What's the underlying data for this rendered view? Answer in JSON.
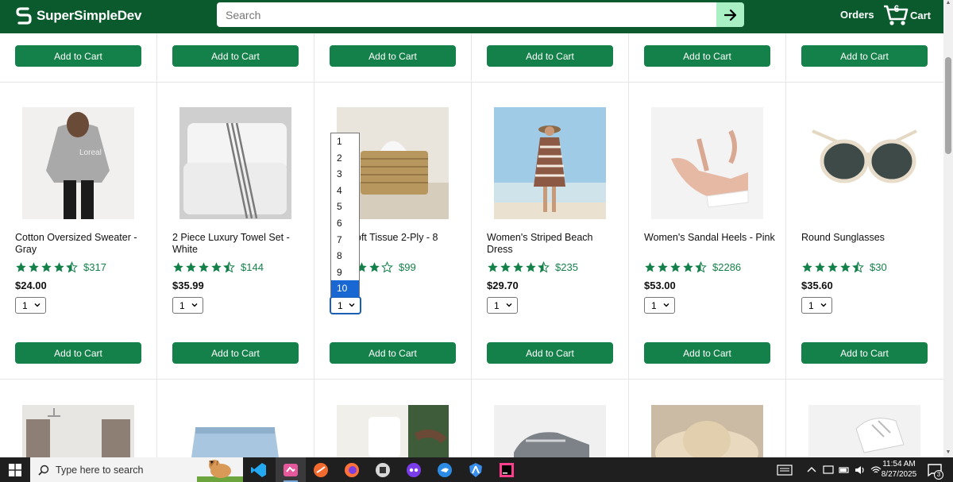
{
  "header": {
    "logo_text": "SuperSimpleDev",
    "search_placeholder": "Search",
    "orders_label": "Orders",
    "cart_label": "Cart",
    "cart_quantity": "6"
  },
  "colors": {
    "header_bg": "#0b5a2e",
    "button_green": "#15814a",
    "search_button": "#a9f0c4",
    "star_gold": "#15814a",
    "dropdown_selected": "#1967d2"
  },
  "add_to_cart_label": "Add to Cart",
  "products": [
    {
      "name": "Cotton Oversized Sweater - Gray",
      "rating_count": "$317",
      "price": "$24.00",
      "quantity": "1",
      "stars": 4.5
    },
    {
      "name": "2 Piece Luxury Towel Set - White",
      "rating_count": "$144",
      "price": "$35.99",
      "quantity": "1",
      "stars": 4.5
    },
    {
      "name": "oft Tissue 2-Ply - 8",
      "rating_count": "$99",
      "price": "",
      "quantity": "1",
      "stars": 4
    },
    {
      "name": "Women's Striped Beach Dress",
      "rating_count": "$235",
      "price": "$29.70",
      "quantity": "1",
      "stars": 4.5
    },
    {
      "name": "Women's Sandal Heels - Pink",
      "rating_count": "$2286",
      "price": "$53.00",
      "quantity": "1",
      "stars": 4.5
    },
    {
      "name": "Round Sunglasses",
      "rating_count": "$30",
      "price": "$35.60",
      "quantity": "1",
      "stars": 4.5
    }
  ],
  "quantity_dropdown": {
    "options": [
      "1",
      "2",
      "3",
      "4",
      "5",
      "6",
      "7",
      "8",
      "9",
      "10"
    ],
    "highlighted": "10"
  },
  "taskbar": {
    "search_placeholder": "Type here to search",
    "time": "11:54 AM",
    "date": "8/27/2025",
    "notification_count": "3",
    "apps": [
      "vscode-icon",
      "app-icon",
      "swift-icon",
      "firefox-icon",
      "window-icon",
      "mask-icon",
      "bird-icon",
      "shield-icon",
      "jetbrains-icon"
    ]
  }
}
